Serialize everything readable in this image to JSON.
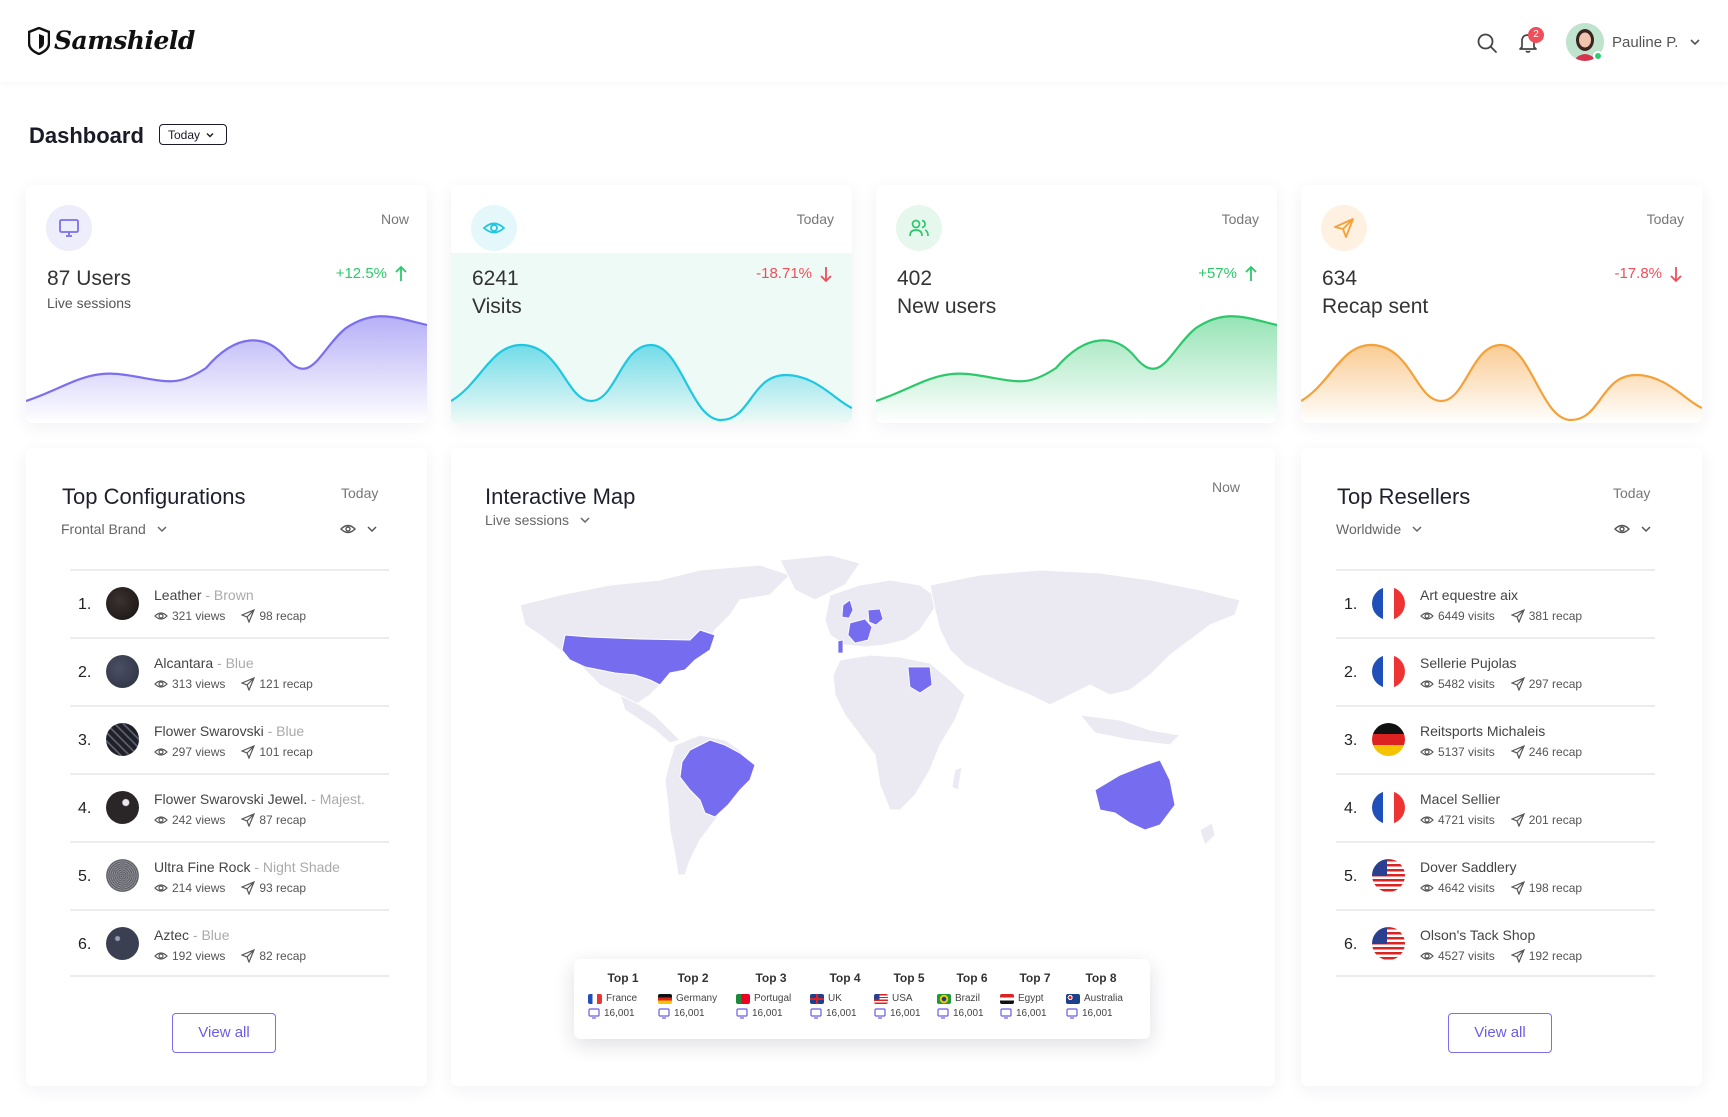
{
  "header": {
    "logo": "Samshield",
    "notifications_count": "2",
    "user_name": "Pauline P."
  },
  "page": {
    "title": "Dashboard",
    "period": "Today"
  },
  "stats": [
    {
      "period": "Now",
      "value": "87 Users",
      "label": "Live sessions",
      "change": "+12.5%",
      "trend": "up",
      "color": "#7b6ef0"
    },
    {
      "period": "Today",
      "value": "6241",
      "label": "Visits",
      "change": "-18.71%",
      "trend": "down",
      "color": "#1fc7e0"
    },
    {
      "period": "Today",
      "value": "402",
      "label": "New users",
      "change": "+57%",
      "trend": "up",
      "color": "#2dc86b"
    },
    {
      "period": "Today",
      "value": "634",
      "label": "Recap sent",
      "change": "-17.8%",
      "trend": "down",
      "color": "#f5a13a"
    }
  ],
  "configurations": {
    "title": "Top Configurations",
    "period": "Today",
    "filter": "Frontal Brand",
    "items": [
      {
        "rank": "1.",
        "name": "Leather",
        "variant": " - Brown",
        "views": "321 views",
        "recap": "98 recap"
      },
      {
        "rank": "2.",
        "name": "Alcantara",
        "variant": " - Blue",
        "views": "313 views",
        "recap": "121 recap"
      },
      {
        "rank": "3.",
        "name": "Flower Swarovski",
        "variant": " - Blue",
        "views": "297 views",
        "recap": "101 recap"
      },
      {
        "rank": "4.",
        "name": "Flower Swarovski Jewel.",
        "variant": " - Majest.",
        "views": "242 views",
        "recap": "87 recap"
      },
      {
        "rank": "5.",
        "name": "Ultra Fine Rock",
        "variant": " - Night Shade",
        "views": "214 views",
        "recap": "93 recap"
      },
      {
        "rank": "6.",
        "name": "Aztec",
        "variant": " - Blue",
        "views": "192 views",
        "recap": "82 recap"
      }
    ],
    "view_all": "View all"
  },
  "map": {
    "title": "Interactive Map",
    "period": "Now",
    "filter": "Live sessions",
    "top": [
      {
        "label": "Top 1",
        "country": "France",
        "value": "16,001"
      },
      {
        "label": "Top 2",
        "country": "Germany",
        "value": "16,001"
      },
      {
        "label": "Top 3",
        "country": "Portugal",
        "value": "16,001"
      },
      {
        "label": "Top 4",
        "country": "UK",
        "value": "16,001"
      },
      {
        "label": "Top 5",
        "country": "USA",
        "value": "16,001"
      },
      {
        "label": "Top 6",
        "country": "Brazil",
        "value": "16,001"
      },
      {
        "label": "Top 7",
        "country": "Egypt",
        "value": "16,001"
      },
      {
        "label": "Top 8",
        "country": "Australia",
        "value": "16,001"
      }
    ]
  },
  "resellers": {
    "title": "Top Resellers",
    "period": "Today",
    "filter": "Worldwide",
    "items": [
      {
        "rank": "1.",
        "name": "Art equestre aix",
        "flag": "france",
        "visits": "6449 visits",
        "recap": "381 recap"
      },
      {
        "rank": "2.",
        "name": "Sellerie Pujolas",
        "flag": "france",
        "visits": "5482 visits",
        "recap": "297 recap"
      },
      {
        "rank": "3.",
        "name": "Reitsports Michaleis",
        "flag": "germany",
        "visits": "5137 visits",
        "recap": "246 recap"
      },
      {
        "rank": "4.",
        "name": "Macel Sellier",
        "flag": "france",
        "visits": "4721 visits",
        "recap": "201 recap"
      },
      {
        "rank": "5.",
        "name": "Dover Saddlery",
        "flag": "usa",
        "visits": "4642 visits",
        "recap": "198 recap"
      },
      {
        "rank": "6.",
        "name": "Olson's Tack Shop",
        "flag": "usa",
        "visits": "4527 visits",
        "recap": "192 recap"
      }
    ],
    "view_all": "View all"
  }
}
